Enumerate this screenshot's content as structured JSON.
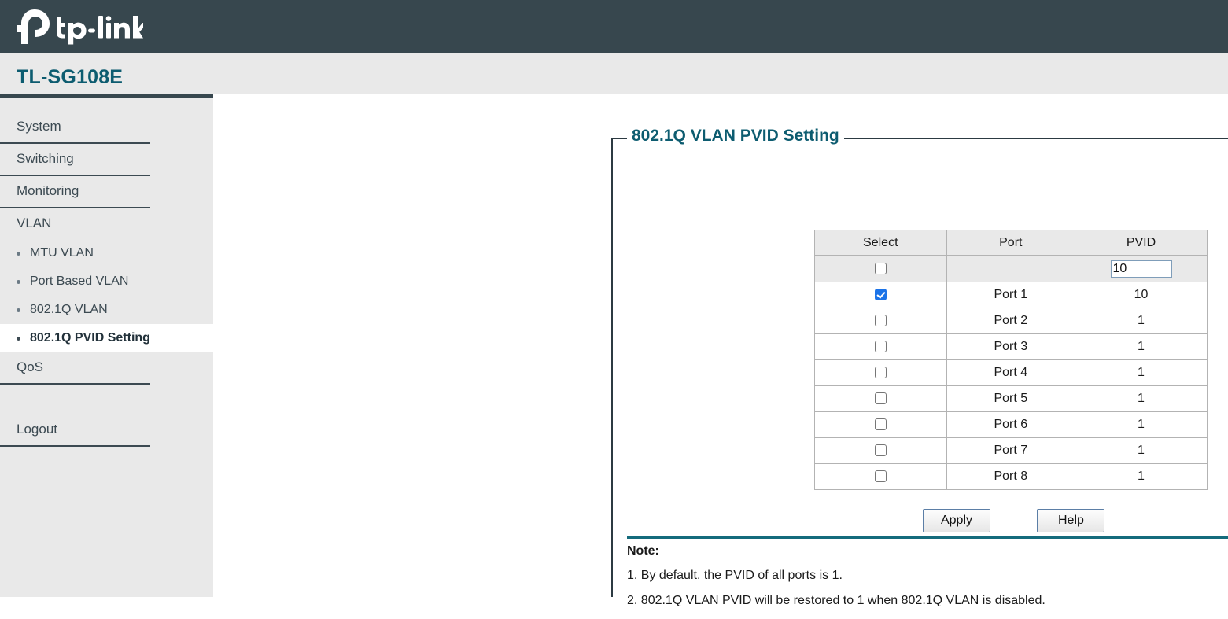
{
  "brand": {
    "logo_icon": "tp-link-logo",
    "logo_text": "tp-link",
    "device_name": "TL-SG108E"
  },
  "sidebar": {
    "items": [
      {
        "label": "System",
        "type": "top",
        "ruled": true,
        "icon": "none"
      },
      {
        "label": "Switching",
        "type": "top",
        "ruled": true,
        "icon": "none"
      },
      {
        "label": "Monitoring",
        "type": "top",
        "ruled": true,
        "icon": "none"
      },
      {
        "label": "VLAN",
        "type": "top",
        "ruled": false,
        "icon": "none"
      },
      {
        "label": "MTU VLAN",
        "type": "sub",
        "active": false,
        "icon": "bullet-icon"
      },
      {
        "label": "Port Based VLAN",
        "type": "sub",
        "active": false,
        "icon": "bullet-icon"
      },
      {
        "label": "802.1Q VLAN",
        "type": "sub",
        "active": false,
        "icon": "bullet-icon"
      },
      {
        "label": "802.1Q PVID Setting",
        "type": "sub",
        "active": true,
        "icon": "bullet-icon"
      },
      {
        "label": "QoS",
        "type": "top",
        "ruled": true,
        "icon": "none"
      },
      {
        "label": "Logout",
        "type": "top",
        "ruled": true,
        "icon": "none"
      }
    ]
  },
  "panel": {
    "title": "802.1Q VLAN PVID Setting"
  },
  "table": {
    "headers": [
      "Select",
      "Port",
      "PVID"
    ],
    "entry_row": {
      "checkbox_checked": false,
      "port": "",
      "pvid_value": "10",
      "pvid_placeholder": ""
    },
    "rows": [
      {
        "selected": true,
        "port": "Port 1",
        "pvid": "10"
      },
      {
        "selected": false,
        "port": "Port 2",
        "pvid": "1"
      },
      {
        "selected": false,
        "port": "Port 3",
        "pvid": "1"
      },
      {
        "selected": false,
        "port": "Port 4",
        "pvid": "1"
      },
      {
        "selected": false,
        "port": "Port 5",
        "pvid": "1"
      },
      {
        "selected": false,
        "port": "Port 6",
        "pvid": "1"
      },
      {
        "selected": false,
        "port": "Port 7",
        "pvid": "1"
      },
      {
        "selected": false,
        "port": "Port 8",
        "pvid": "1"
      }
    ]
  },
  "buttons": {
    "apply": "Apply",
    "help": "Help"
  },
  "note": {
    "title": "Note:",
    "lines": [
      "1. By default, the PVID of all ports is 1.",
      "2. 802.1Q VLAN PVID will be restored to 1 when 802.1Q VLAN is disabled."
    ]
  },
  "colors": {
    "brand_bar": "#37474e",
    "band": "#e9e9e9",
    "teal": "#0d5c70",
    "note_rule": "#146b7c",
    "checkbox_checked": "#1b73e8",
    "input_border": "#7f9db9"
  }
}
